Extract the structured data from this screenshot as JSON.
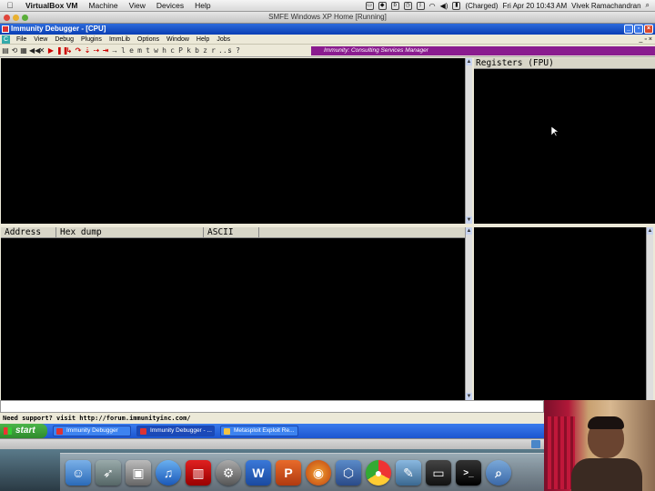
{
  "mac_menubar": {
    "app_name": "VirtualBox VM",
    "menus": [
      "Machine",
      "View",
      "Devices",
      "Help"
    ],
    "battery_text": "(Charged)",
    "clock": "Fri Apr 20  10:43 AM",
    "user": "Vivek Ramachandran"
  },
  "vbox_window": {
    "title": "SMFE Windows XP Home [Running]"
  },
  "xp_window": {
    "title": "Immunity Debugger - [CPU]",
    "menus": [
      "File",
      "View",
      "Debug",
      "Plugins",
      "ImmLib",
      "Options",
      "Window",
      "Help",
      "Jobs"
    ],
    "toolbar_letters": [
      "l",
      "e",
      "m",
      "t",
      "w",
      "h",
      "c",
      "P",
      "k",
      "b",
      "z",
      "r",
      "...",
      "s",
      "?"
    ],
    "banner": "Immunity: Consulting Services Manager"
  },
  "panes": {
    "registers_title": "Registers (FPU)",
    "dump_headers": [
      "Address",
      "Hex dump",
      "ASCII"
    ]
  },
  "status_text": "Need support? visit http://forum.immunityinc.com/",
  "xp_taskbar": {
    "start_label": "start",
    "tasks": [
      {
        "label": "Immunity Debugger",
        "active": false
      },
      {
        "label": "Immunity Debugger - ...",
        "active": true
      },
      {
        "label": "Metasploit Exploit Re...",
        "active": false
      }
    ]
  },
  "dock_icons": [
    "finder-icon",
    "rocket-icon",
    "preview-icon",
    "itunes-icon",
    "photobooth-icon",
    "system-preferences-icon",
    "word-icon",
    "powerpoint-icon",
    "firefox-icon",
    "virtualbox-icon",
    "chrome-icon",
    "xcode-icon",
    "screen-icon",
    "terminal-icon",
    "search-icon"
  ]
}
